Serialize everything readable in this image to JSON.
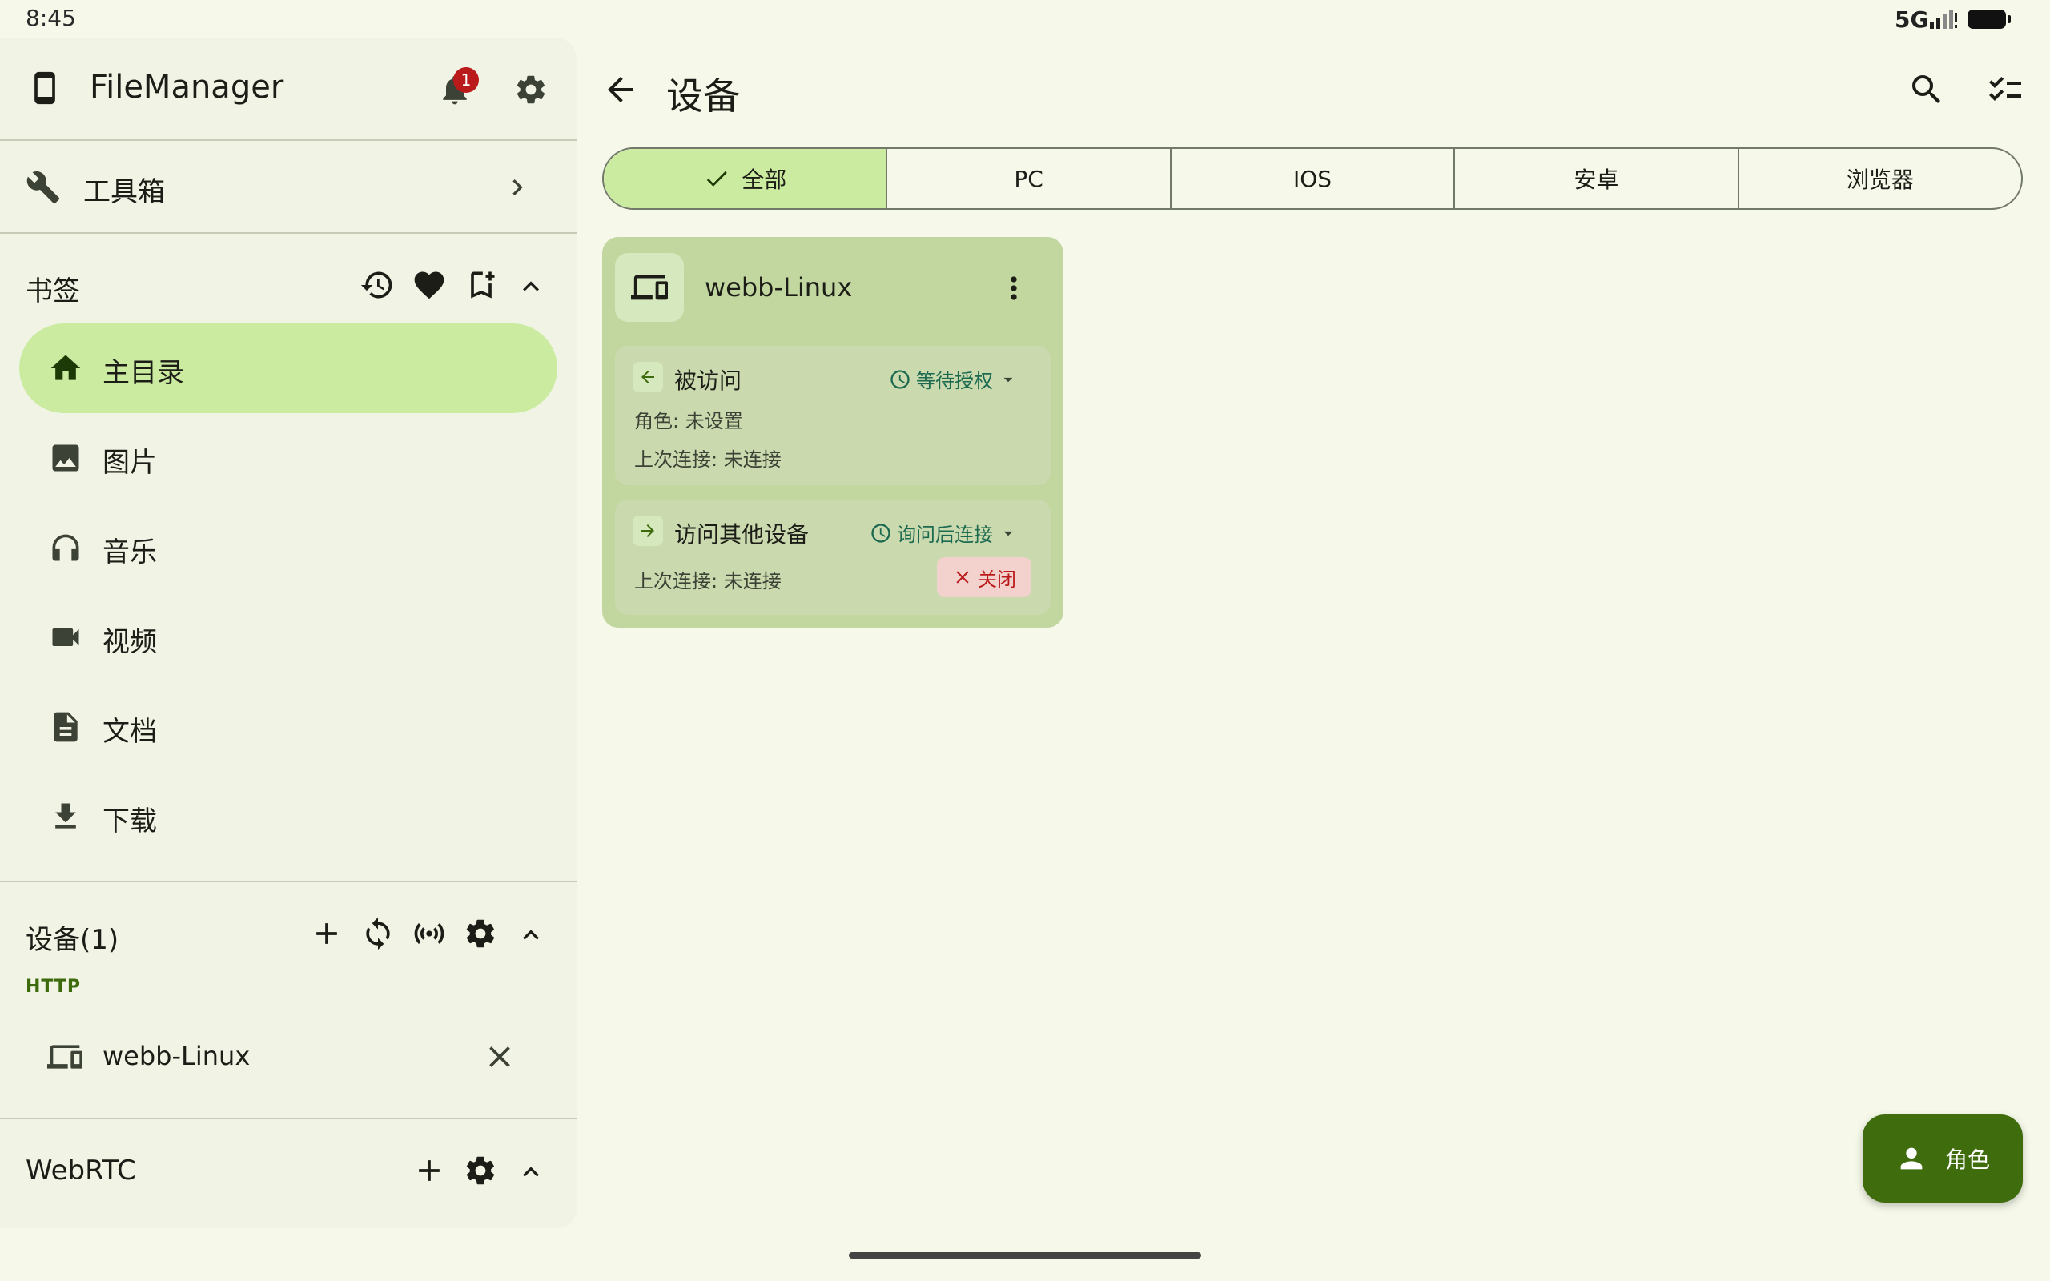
{
  "status_bar": {
    "time": "8:45",
    "network": "5G"
  },
  "sidebar": {
    "app_title": "FileManager",
    "notification_count": "1",
    "toolbox_label": "工具箱",
    "bookmarks": {
      "header": "书签",
      "items": [
        {
          "label": "主目录",
          "icon": "home-icon"
        },
        {
          "label": "图片",
          "icon": "image-icon"
        },
        {
          "label": "音乐",
          "icon": "headphones-icon"
        },
        {
          "label": "视频",
          "icon": "video-icon"
        },
        {
          "label": "文档",
          "icon": "document-icon"
        },
        {
          "label": "下载",
          "icon": "download-icon"
        }
      ]
    },
    "devices": {
      "header": "设备(1)",
      "protocol": "HTTP",
      "items": [
        {
          "label": "webb-Linux"
        }
      ]
    },
    "webrtc": {
      "header": "WebRTC"
    }
  },
  "main": {
    "title": "设备",
    "tabs": [
      "全部",
      "PC",
      "IOS",
      "安卓",
      "浏览器"
    ],
    "selected_tab": "全部",
    "card": {
      "name": "webb-Linux",
      "incoming": {
        "title": "被访问",
        "status": "等待授权",
        "role_line": "角色: 未设置",
        "last_line": "上次连接: 未连接"
      },
      "outgoing": {
        "title": "访问其他设备",
        "status": "询问后连接",
        "last_line": "上次连接: 未连接",
        "close_label": "关闭"
      }
    },
    "fab_label": "角色"
  },
  "colors": {
    "background": "#f6f9ea",
    "sidebar": "#f1f3e5",
    "accent_container": "#cbeba0",
    "card": "#c2d7a0",
    "fab": "#3f6d0e",
    "status_green": "#1b6a50",
    "error": "#ba1a1a"
  }
}
